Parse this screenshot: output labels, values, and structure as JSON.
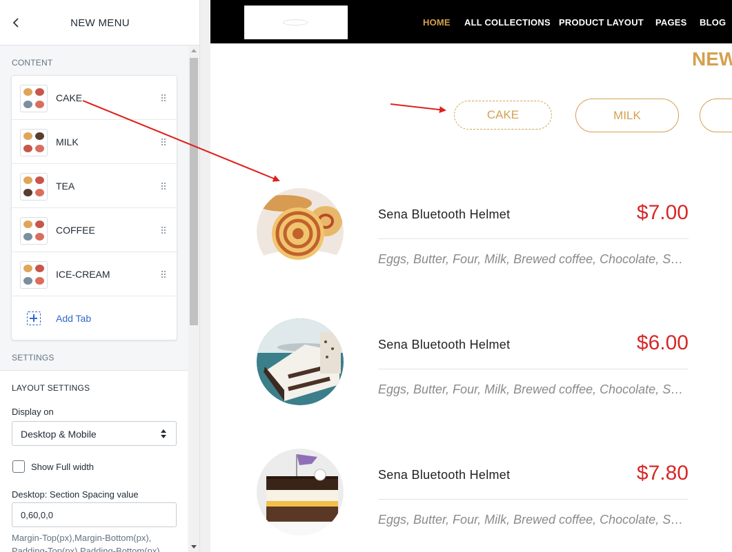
{
  "sidebar": {
    "title": "NEW MENU",
    "back_icon": "chevron-left-icon",
    "content_label": "CONTENT",
    "tabs": [
      {
        "label": "CAKE"
      },
      {
        "label": "MILK"
      },
      {
        "label": "TEA"
      },
      {
        "label": "COFFEE"
      },
      {
        "label": "ICE-CREAM"
      }
    ],
    "add_tab_label": "Add Tab",
    "settings_label": "SETTINGS",
    "layout_settings_label": "LAYOUT SETTINGS",
    "display_on_label": "Display on",
    "display_on_value": "Desktop & Mobile",
    "show_full_width_label": "Show Full width",
    "show_full_width_checked": false,
    "spacing_label": "Desktop: Section Spacing value",
    "spacing_value": "0,60,0,0",
    "spacing_help": "Margin-Top(px),Margin-Bottom(px), Padding-Top(px),Padding-Bottom(px)"
  },
  "preview": {
    "nav": [
      "HOME",
      "ALL COLLECTIONS",
      "PRODUCT LAYOUT",
      "PAGES",
      "BLOG"
    ],
    "heading": "NEW",
    "category_tabs": [
      "CAKE",
      "MILK"
    ],
    "items": [
      {
        "name": "Sena Bluetooth Helmet",
        "price": "$7.00",
        "description": "Eggs, Butter, Four, Milk, Brewed coffee, Chocolate, Sugar"
      },
      {
        "name": "Sena Bluetooth Helmet",
        "price": "$6.00",
        "description": "Eggs, Butter, Four, Milk, Brewed coffee, Chocolate, Sugar"
      },
      {
        "name": "Sena Bluetooth Helmet",
        "price": "$7.80",
        "description": "Eggs, Butter, Four, Milk, Brewed coffee, Chocolate, Sugar"
      }
    ]
  },
  "colors": {
    "accent_gold": "#d4a04f",
    "price_red": "#d62828",
    "link_blue": "#3266cc",
    "annotation_red": "#e0201a"
  }
}
